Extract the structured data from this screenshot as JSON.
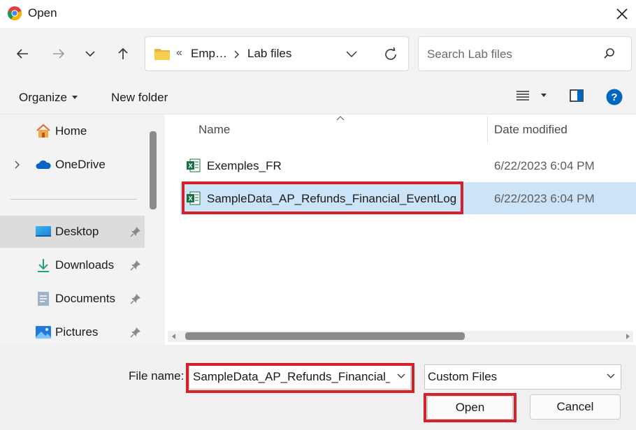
{
  "window": {
    "title": "Open",
    "close_icon": "close-icon"
  },
  "nav": {
    "breadcrumb": {
      "overflow": "«",
      "segments": [
        "Emp…",
        "Lab files"
      ]
    },
    "search_placeholder": "Search Lab files"
  },
  "toolbar": {
    "organize_label": "Organize",
    "new_folder_label": "New folder"
  },
  "sidebar": {
    "items": [
      {
        "label": "Home",
        "icon": "home-icon"
      },
      {
        "label": "OneDrive",
        "icon": "onedrive-icon"
      },
      {
        "label": "Desktop",
        "icon": "desktop-icon",
        "selected": true,
        "pinned": true
      },
      {
        "label": "Downloads",
        "icon": "downloads-icon",
        "pinned": true
      },
      {
        "label": "Documents",
        "icon": "documents-icon",
        "pinned": true
      },
      {
        "label": "Pictures",
        "icon": "pictures-icon",
        "pinned": true
      }
    ]
  },
  "file_list": {
    "columns": {
      "name": "Name",
      "date": "Date modified"
    },
    "rows": [
      {
        "name": "Exemples_FR",
        "date": "6/22/2023 6:04 PM",
        "icon": "excel-file-icon",
        "selected": false
      },
      {
        "name": "SampleData_AP_Refunds_Financial_EventLog",
        "date": "6/22/2023 6:04 PM",
        "icon": "excel-file-icon",
        "selected": true
      }
    ]
  },
  "footer": {
    "file_name_label": "File name:",
    "file_name_value": "SampleData_AP_Refunds_Financial_E",
    "file_type_value": "Custom Files",
    "open_label": "Open",
    "cancel_label": "Cancel"
  },
  "colors": {
    "accent": "#0067c0",
    "highlight": "#d6202a",
    "selection": "#cce4f7"
  }
}
